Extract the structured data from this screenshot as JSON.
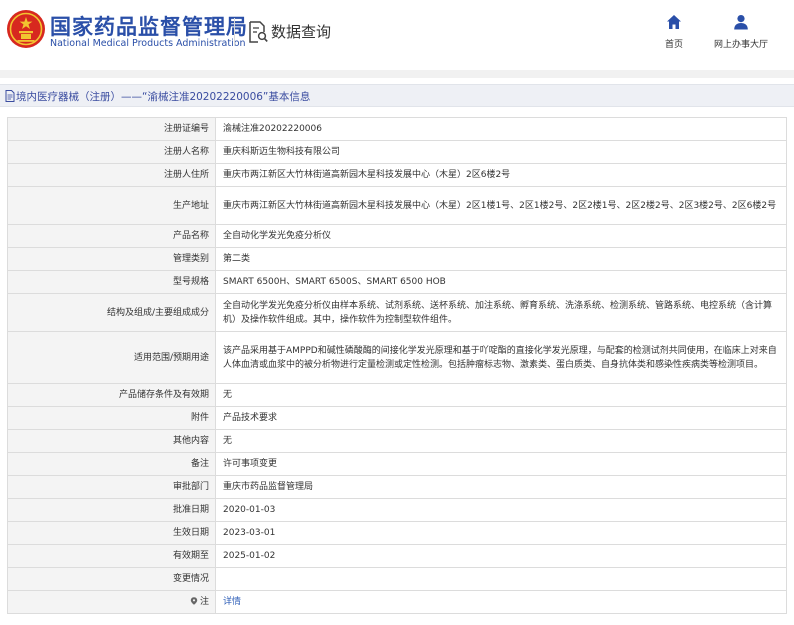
{
  "header": {
    "org_name_cn": "国家药品监督管理局",
    "org_name_en": "National Medical Products Administration",
    "section_title": "数据查询",
    "nav": {
      "home_label": "首页",
      "online_label": "网上办事大厅"
    }
  },
  "page_title": "境内医疗器械（注册）——“渝械注准20202220006”基本信息",
  "colors": {
    "brand_blue": "#2a4fa8",
    "emblem_red": "#d7281f",
    "link_blue": "#2f5fb8"
  },
  "icons": {
    "emblem": "national-emblem-icon",
    "query": "document-search-icon",
    "home": "home-icon",
    "online": "user-icon",
    "title": "document-icon",
    "note": "marker-icon"
  },
  "info": {
    "rows": [
      {
        "label": "注册证编号",
        "value": "渝械注准20202220006"
      },
      {
        "label": "注册人名称",
        "value": "重庆科斯迈生物科技有限公司"
      },
      {
        "label": "注册人住所",
        "value": "重庆市两江新区大竹林街道高新园木星科技发展中心（木星）2区6楼2号"
      },
      {
        "label": "生产地址",
        "value": "重庆市两江新区大竹林街道高新园木星科技发展中心（木星）2区1楼1号、2区1楼2号、2区2楼1号、2区2楼2号、2区3楼2号、2区6楼2号"
      },
      {
        "label": "产品名称",
        "value": "全自动化学发光免疫分析仪"
      },
      {
        "label": "管理类别",
        "value": "第二类"
      },
      {
        "label": "型号规格",
        "value": "SMART 6500H、SMART 6500S、SMART 6500 HOB"
      },
      {
        "label": "结构及组成/主要组成成分",
        "value": "全自动化学发光免疫分析仪由样本系统、试剂系统、送杯系统、加注系统、孵育系统、洗涤系统、检测系统、管路系统、电控系统（含计算机）及操作软件组成。其中，操作软件为控制型软件组件。"
      },
      {
        "label": "适用范围/预期用途",
        "value": "该产品采用基于AMPPD和碱性磷酸酶的间接化学发光原理和基于吖啶酯的直接化学发光原理，与配套的检测试剂共同使用，在临床上对来自人体血清或血浆中的被分析物进行定量检测或定性检测。包括肿瘤标志物、激素类、蛋白质类、自身抗体类和感染性疾病类等检测项目。"
      },
      {
        "label": "产品储存条件及有效期",
        "value": "无"
      },
      {
        "label": "附件",
        "value": "产品技术要求"
      },
      {
        "label": "其他内容",
        "value": "无"
      },
      {
        "label": "备注",
        "value": "许可事项变更"
      },
      {
        "label": "审批部门",
        "value": "重庆市药品监督管理局"
      },
      {
        "label": "批准日期",
        "value": "2020-01-03"
      },
      {
        "label": "生效日期",
        "value": "2023-03-01"
      },
      {
        "label": "有效期至",
        "value": "2025-01-02"
      },
      {
        "label": "变更情况",
        "value": ""
      },
      {
        "label": "注",
        "value": "详情"
      }
    ]
  }
}
